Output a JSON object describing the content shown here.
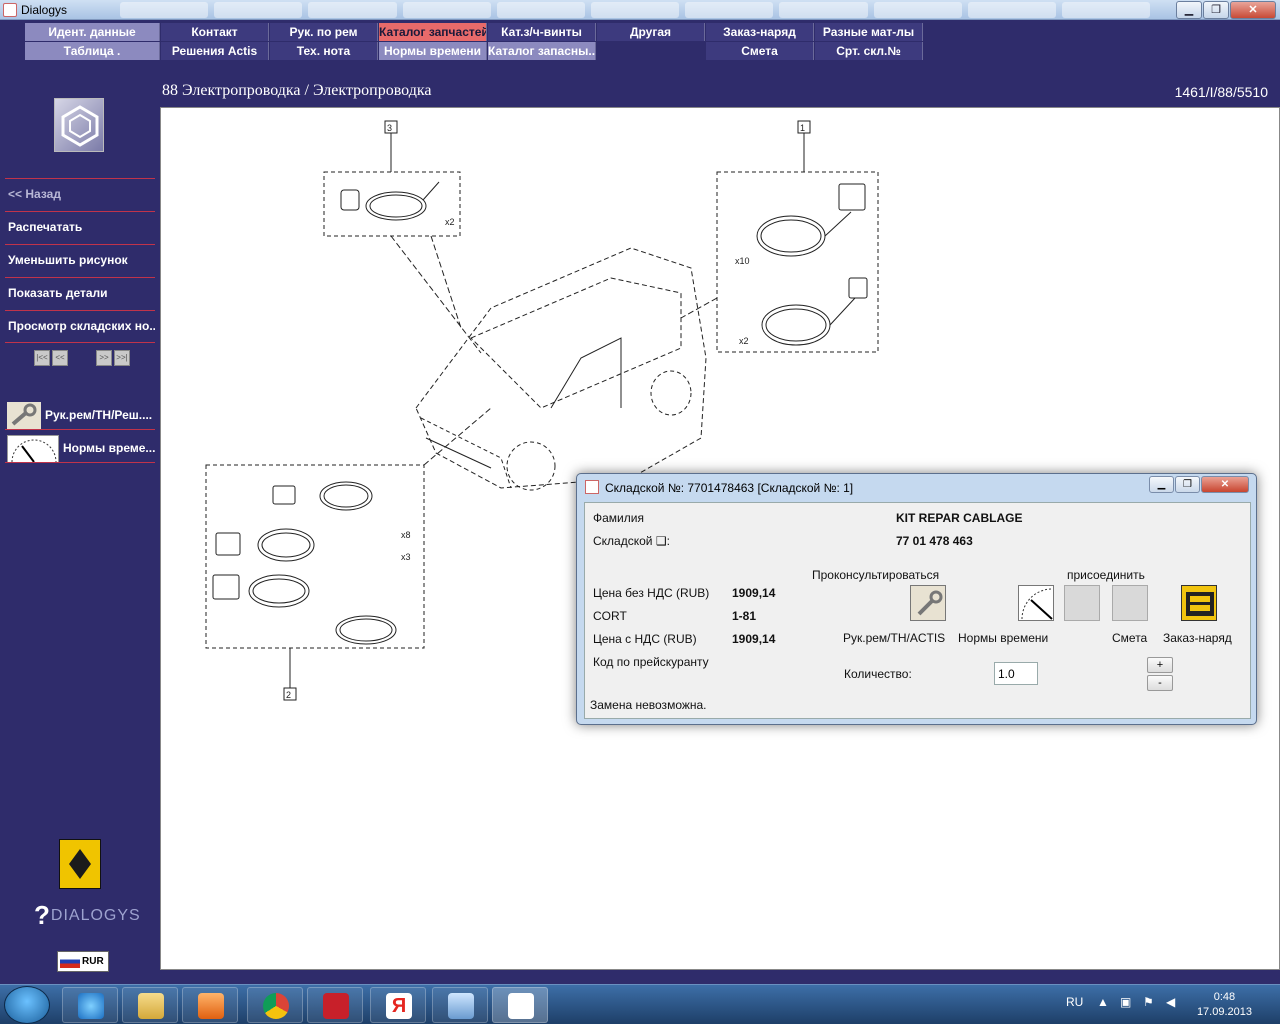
{
  "window": {
    "title": "Dialogys"
  },
  "menu": {
    "row1": [
      "Идент. данные",
      "Контакт",
      "Рук. по рем",
      "Каталог запчастей",
      "Кат.з/ч-винты",
      "Другая",
      "Заказ-наряд",
      "Разные мат-лы"
    ],
    "row2": [
      "Таблица .",
      "Решения Actis",
      "Тех. нота",
      "Нормы времени",
      "Каталог запасны...",
      "",
      "Смета",
      "Срт. скл.№"
    ]
  },
  "page": {
    "title": "88 Электропроводка / Электропроводка",
    "ref": "1461/I/88/5510"
  },
  "sidebar": {
    "items": [
      "<< Назад",
      "Распечатать",
      "Уменьшить рисунок",
      "Показать детали",
      "Просмотр складских но..."
    ],
    "pager": [
      "|<<",
      "<<",
      "",
      ">>",
      ">>|"
    ],
    "tools": [
      "Рук.рем/ТН/Реш....",
      "Нормы време..."
    ],
    "brand": "DIALOGYS",
    "currency": "RUR"
  },
  "diagram": {
    "callouts": [
      "3",
      "1",
      "2"
    ],
    "quantities": [
      "x2",
      "x10",
      "x2",
      "x8",
      "x3"
    ]
  },
  "dialog": {
    "title": "Складской №: 7701478463 [Складской №: 1]",
    "family_label": "Фамилия",
    "family_value": "KIT REPAR CABLAGE",
    "stock_label": "Складской ❑:",
    "stock_value": "77 01 478 463",
    "price_net_label": "Цена без НДС (RUB)",
    "price_net_value": "1909,14",
    "cort_label": "CORT",
    "cort_value": "1-81",
    "price_vat_label": "Цена с НДС (RUB)",
    "price_vat_value": "1909,14",
    "pricelist_label": "Код по прейскуранту",
    "consult_label": "Проконсультироваться",
    "attach_label": "присоединить",
    "icon_labels": [
      "Рук.рем/ТН/ACTIS",
      "Нормы времени",
      "Смета",
      "Заказ-наряд"
    ],
    "qty_label": "Количество:",
    "qty_value": "1.0",
    "plus": "+",
    "minus": "-",
    "status": "Замена невозможна."
  },
  "taskbar": {
    "lang": "RU",
    "time": "0:48",
    "date": "17.09.2013"
  }
}
